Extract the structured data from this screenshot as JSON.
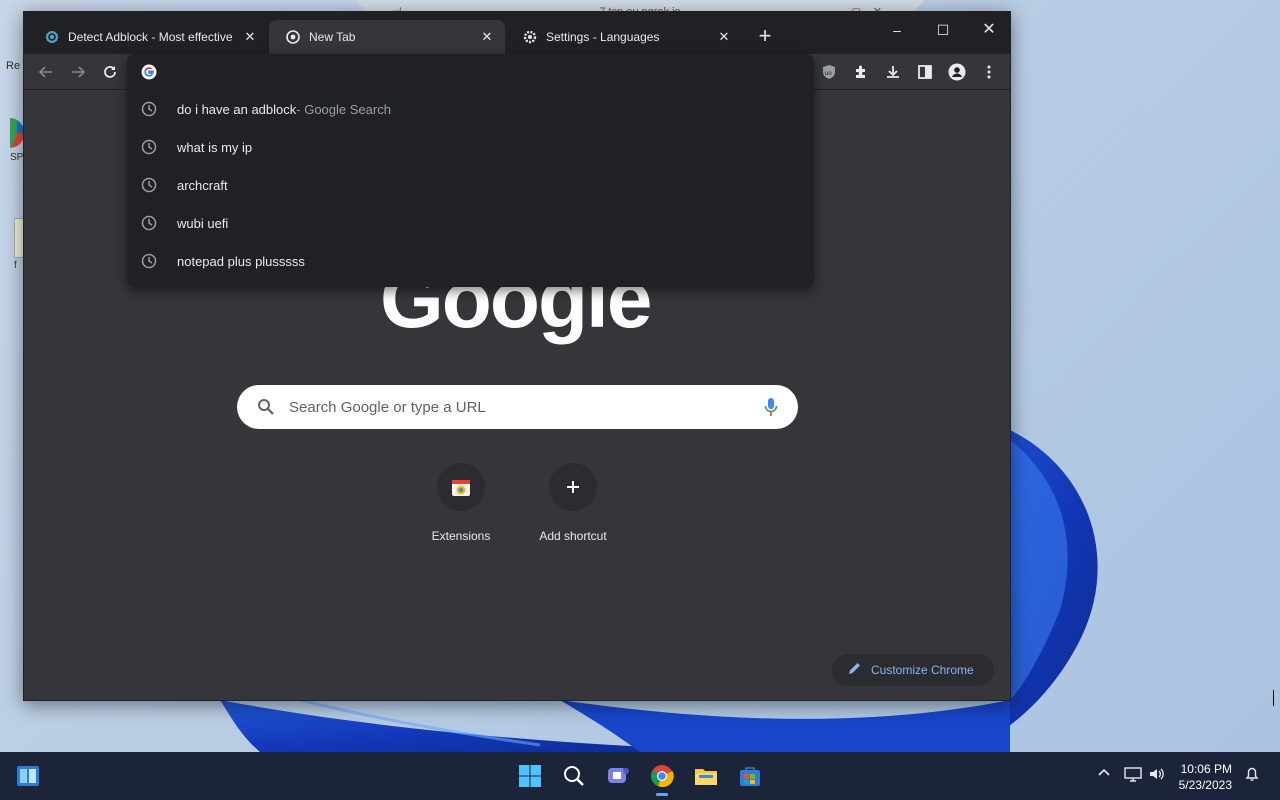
{
  "desktop": {
    "icons": [
      {
        "label": "Re"
      },
      {
        "label": "SP"
      },
      {
        "label": "f"
      }
    ],
    "remote_bar": {
      "title": "7.tcp.eu.ngrok.io"
    }
  },
  "chrome": {
    "tabs": [
      {
        "title": "Detect Adblock - Most effective",
        "icon": "adblock-detect-icon",
        "active": false
      },
      {
        "title": "New Tab",
        "icon": "chrome-icon",
        "active": true
      },
      {
        "title": "Settings - Languages",
        "icon": "gear-icon",
        "active": false
      }
    ],
    "omnibox": {
      "value": "",
      "suggestions": [
        {
          "text": "do i have an adblock",
          "hint": " - Google Search"
        },
        {
          "text": "what is my ip",
          "hint": ""
        },
        {
          "text": "archcraft",
          "hint": ""
        },
        {
          "text": "wubi uefi",
          "hint": ""
        },
        {
          "text": "notepad plus plusssss",
          "hint": ""
        }
      ]
    },
    "ntp": {
      "logo": "Google",
      "search_placeholder": "Search Google or type a URL",
      "shortcuts": [
        {
          "label": "Extensions"
        },
        {
          "label": "Add shortcut"
        }
      ],
      "customize_label": "Customize Chrome"
    }
  },
  "taskbar": {
    "time": "10:06 PM",
    "date": "5/23/2023"
  },
  "colors": {
    "window_bg": "#35363a",
    "tabstrip_bg": "#202124",
    "link_blue": "#8ab4f8",
    "taskbar_bg": "#1b2438"
  }
}
